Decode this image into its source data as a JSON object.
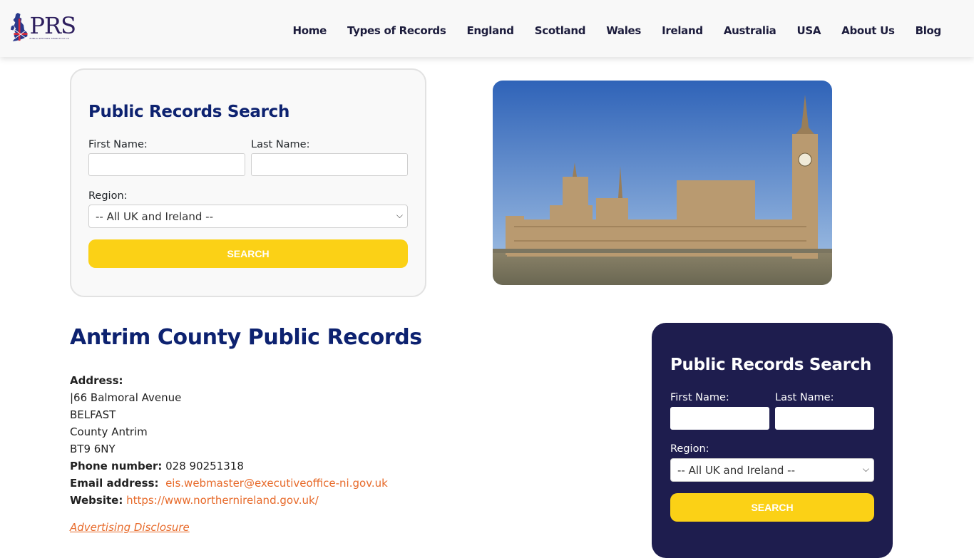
{
  "header": {
    "logo": {
      "main": "PRS",
      "sub": "PUBLIC RECORDS SEARCH CO UK",
      "icon": "uk-map-flag-icon"
    },
    "nav": [
      "Home",
      "Types of Records",
      "England",
      "Scotland",
      "Wales",
      "Ireland",
      "Australia",
      "USA",
      "About Us",
      "Blog"
    ]
  },
  "search_top": {
    "title": "Public Records Search",
    "first_name_label": "First Name:",
    "first_name_value": "",
    "last_name_label": "Last Name:",
    "last_name_value": "",
    "region_label": "Region:",
    "region_selected": "-- All UK and Ireland --",
    "button": "SEARCH"
  },
  "hero": {
    "alt": "Houses of Parliament and Big Ben, London"
  },
  "main": {
    "title": "Antrim County Public Records",
    "address_label": "Address:",
    "address_lines": [
      "|66 Balmoral Avenue",
      "BELFAST",
      "County Antrim",
      "BT9 6NY"
    ],
    "phone_label": "Phone number:",
    "phone": "028 90251318",
    "email_label": "Email address:",
    "email": "eis.webmaster@executiveoffice-ni.gov.uk",
    "website_label": "Website:",
    "website": "https://www.northernireland.gov.uk/",
    "ad_disclosure": "Advertising Disclosure"
  },
  "search_side": {
    "title": "Public Records Search",
    "first_name_label": "First Name:",
    "first_name_value": "",
    "last_name_label": "Last Name:",
    "last_name_value": "",
    "region_label": "Region:",
    "region_selected": "-- All UK and Ireland --",
    "button": "SEARCH"
  },
  "colors": {
    "brand_navy": "#0d2270",
    "dark_card": "#1e1d4e",
    "button_yellow": "#fbd116",
    "link_orange": "#e76a2a"
  }
}
